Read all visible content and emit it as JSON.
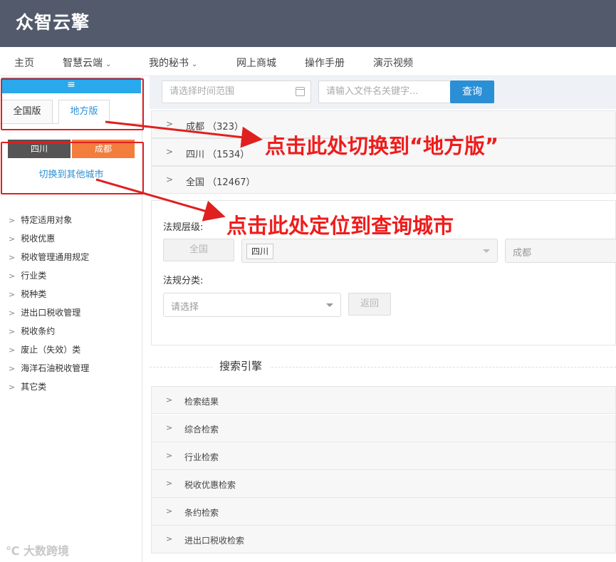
{
  "header": {
    "logo_text": "众智云擎"
  },
  "nav": {
    "items": [
      {
        "label": "主页",
        "dropdown": false
      },
      {
        "label": "智慧云端",
        "dropdown": true
      },
      {
        "label": "我的秘书",
        "dropdown": true
      },
      {
        "label": "网上商城",
        "dropdown": false
      },
      {
        "label": "操作手册",
        "dropdown": false
      },
      {
        "label": "演示视频",
        "dropdown": false
      }
    ],
    "chevron": "⌄"
  },
  "sidebar": {
    "collapse_icon": "≡",
    "tabs": [
      {
        "label": "全国版",
        "active": false
      },
      {
        "label": "地方版",
        "active": true
      }
    ],
    "province": "四川",
    "city": "成都",
    "switch_city_link": "切换到其他城市",
    "categories": [
      "特定适用对象",
      "税收优惠",
      "税收管理通用规定",
      "行业类",
      "税种类",
      "进出口税收管理",
      "税收条约",
      "废止（失效）类",
      "海洋石油税收管理",
      "其它类"
    ]
  },
  "filter": {
    "date_placeholder": "请选择时间范围",
    "keyword_placeholder": "请输入文件名关键字...",
    "query_button": "查询"
  },
  "region_panels": [
    {
      "name": "成都",
      "count": "（323）"
    },
    {
      "name": "四川",
      "count": "（1534）"
    },
    {
      "name": "全国",
      "count": "（12467）"
    }
  ],
  "form": {
    "level_label": "法规层级:",
    "national_button": "全国",
    "province_tag": "四川",
    "city_placeholder": "成都",
    "category_label": "法规分类:",
    "category_placeholder": "请选择",
    "back_button": "返回"
  },
  "search_engine": {
    "title": "搜索引擎",
    "items": [
      "检索结果",
      "综合检索",
      "行业检索",
      "税收优惠检索",
      "条约检索",
      "进出口税收检索"
    ]
  },
  "annotations": {
    "switch_note": "点击此处切换到“地方版”",
    "locate_note": "点击此处定位到查询城市"
  },
  "watermark": "大数跨境",
  "colors": {
    "header_bg": "#525a6c",
    "accent_blue": "#2b8fd6",
    "city_orange": "#f27d3d",
    "province_gray": "#555555",
    "annotation_red": "#ef1c1c"
  }
}
